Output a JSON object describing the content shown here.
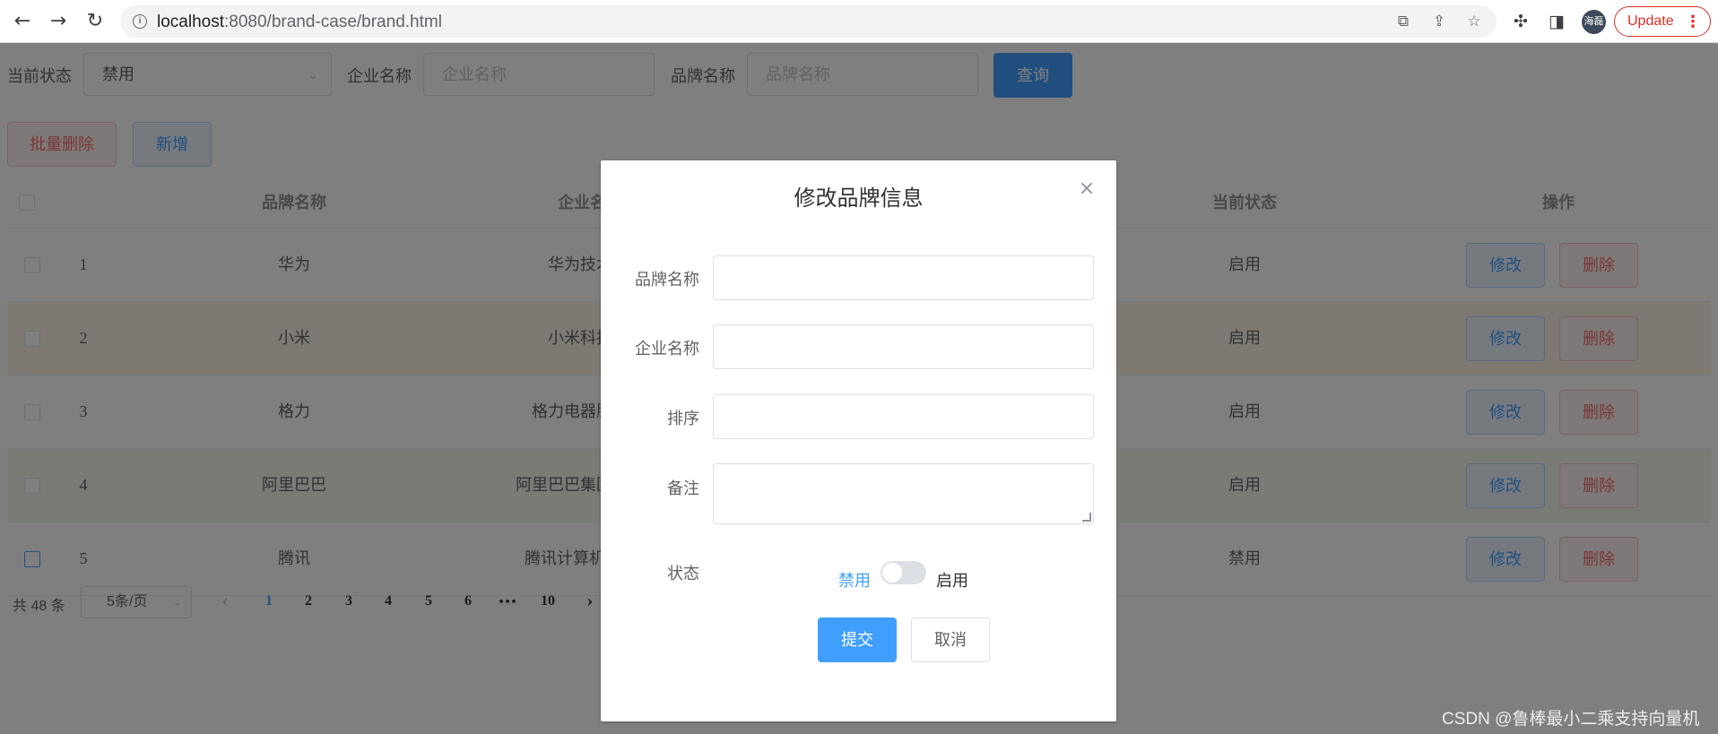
{
  "browser": {
    "url_host": "localhost",
    "url_rest": ":8080/brand-case/brand.html",
    "profile_label": "海磊",
    "update_label": "Update"
  },
  "search": {
    "status_label": "当前状态",
    "status_value": "禁用",
    "company_label": "企业名称",
    "company_placeholder": "企业名称",
    "brand_label": "品牌名称",
    "brand_placeholder": "品牌名称",
    "query_label": "查询"
  },
  "actions": {
    "batch_delete_label": "批量删除",
    "add_label": "新增"
  },
  "table": {
    "headers": {
      "brand": "品牌名称",
      "company": "企业名称",
      "status": "当前状态",
      "ops": "操作"
    },
    "rows": [
      {
        "index": "1",
        "brand": "华为",
        "company": "华为技术有限公司",
        "status": "启用"
      },
      {
        "index": "2",
        "brand": "小米",
        "company": "小米科技有限公司",
        "status": "启用"
      },
      {
        "index": "3",
        "brand": "格力",
        "company": "格力电器股份有限公司",
        "status": "启用"
      },
      {
        "index": "4",
        "brand": "阿里巴巴",
        "company": "阿里巴巴集团控股有限公司",
        "status": "启用"
      },
      {
        "index": "5",
        "brand": "腾讯",
        "company": "腾讯计算机系统有限公司",
        "status": "禁用"
      }
    ],
    "edit_label": "修改",
    "delete_label": "删除"
  },
  "pager": {
    "total": "共 48 条",
    "page_size": "5条/页",
    "prev": "‹",
    "next": "›",
    "pages": [
      "1",
      "2",
      "3",
      "4",
      "5",
      "6",
      "•••",
      "10"
    ]
  },
  "dialog": {
    "title": "修改品牌信息",
    "brand_label": "品牌名称",
    "company_label": "企业名称",
    "order_label": "排序",
    "remark_label": "备注",
    "status_label": "状态",
    "switch_off_label": "禁用",
    "switch_on_label": "启用",
    "submit_label": "提交",
    "cancel_label": "取消"
  },
  "watermark": "CSDN @鲁棒最小二乘支持向量机"
}
